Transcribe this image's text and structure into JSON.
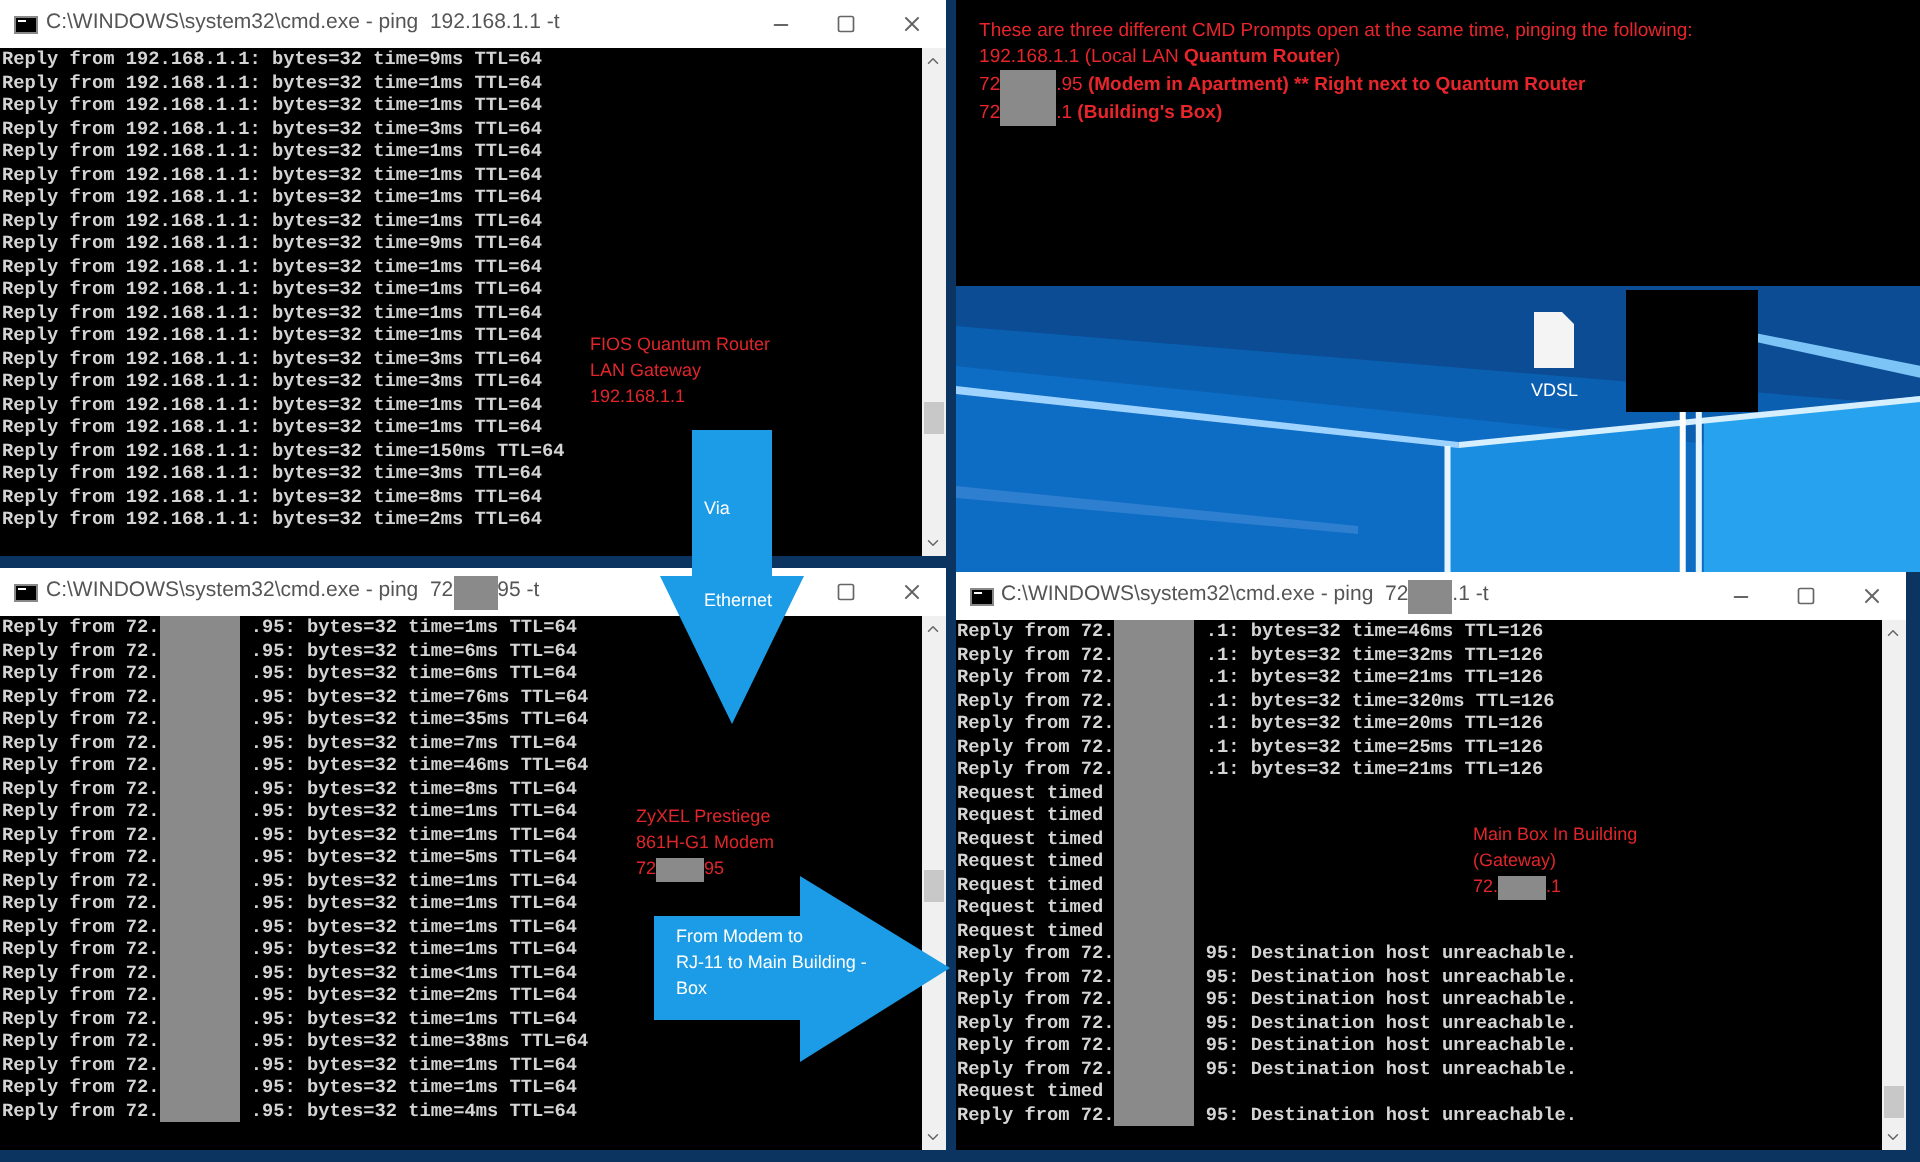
{
  "windows": [
    {
      "title": [
        {
          "kind": "text",
          "text": "C:\\WINDOWS\\system32\\cmd.exe - ping  192.168.1.1 -t"
        }
      ],
      "lines": [
        {
          "text": "Reply from 192.168.1.1: bytes=32 time=9ms TTL=64"
        },
        {
          "text": "Reply from 192.168.1.1: bytes=32 time=1ms TTL=64"
        },
        {
          "text": "Reply from 192.168.1.1: bytes=32 time=1ms TTL=64"
        },
        {
          "text": "Reply from 192.168.1.1: bytes=32 time=3ms TTL=64"
        },
        {
          "text": "Reply from 192.168.1.1: bytes=32 time=1ms TTL=64"
        },
        {
          "text": "Reply from 192.168.1.1: bytes=32 time=1ms TTL=64"
        },
        {
          "text": "Reply from 192.168.1.1: bytes=32 time=1ms TTL=64"
        },
        {
          "text": "Reply from 192.168.1.1: bytes=32 time=1ms TTL=64"
        },
        {
          "text": "Reply from 192.168.1.1: bytes=32 time=9ms TTL=64"
        },
        {
          "text": "Reply from 192.168.1.1: bytes=32 time=1ms TTL=64"
        },
        {
          "text": "Reply from 192.168.1.1: bytes=32 time=1ms TTL=64"
        },
        {
          "text": "Reply from 192.168.1.1: bytes=32 time=1ms TTL=64"
        },
        {
          "text": "Reply from 192.168.1.1: bytes=32 time=1ms TTL=64"
        },
        {
          "text": "Reply from 192.168.1.1: bytes=32 time=3ms TTL=64"
        },
        {
          "text": "Reply from 192.168.1.1: bytes=32 time=3ms TTL=64"
        },
        {
          "text": "Reply from 192.168.1.1: bytes=32 time=1ms TTL=64"
        },
        {
          "text": "Reply from 192.168.1.1: bytes=32 time=1ms TTL=64"
        },
        {
          "text": "Reply from 192.168.1.1: bytes=32 time=150ms TTL=64"
        },
        {
          "text": "Reply from 192.168.1.1: bytes=32 time=3ms TTL=64"
        },
        {
          "text": "Reply from 192.168.1.1: bytes=32 time=8ms TTL=64"
        },
        {
          "text": "Reply from 192.168.1.1: bytes=32 time=2ms TTL=64"
        }
      ],
      "annotation": [
        [
          {
            "kind": "text",
            "text": "FIOS Quantum Router"
          }
        ],
        [
          {
            "kind": "text",
            "text": "LAN Gateway"
          }
        ],
        [
          {
            "kind": "text",
            "text": "192.168.1.1"
          }
        ]
      ]
    },
    {
      "title": [
        {
          "kind": "text",
          "text": "C:\\WINDOWS\\system32\\cmd.exe - ping  72"
        },
        {
          "kind": "redacted"
        },
        {
          "kind": "text",
          "text": "95 -t"
        }
      ],
      "lines": [
        {
          "before": "Reply from 72.",
          "after": ".95: bytes=32 time=1ms TTL=64"
        },
        {
          "before": "Reply from 72.",
          "after": ".95: bytes=32 time=6ms TTL=64"
        },
        {
          "before": "Reply from 72.",
          "after": ".95: bytes=32 time=6ms TTL=64"
        },
        {
          "before": "Reply from 72.",
          "after": ".95: bytes=32 time=76ms TTL=64"
        },
        {
          "before": "Reply from 72.",
          "after": ".95: bytes=32 time=35ms TTL=64"
        },
        {
          "before": "Reply from 72.",
          "after": ".95: bytes=32 time=7ms TTL=64"
        },
        {
          "before": "Reply from 72.",
          "after": ".95: bytes=32 time=46ms TTL=64"
        },
        {
          "before": "Reply from 72.",
          "after": ".95: bytes=32 time=8ms TTL=64"
        },
        {
          "before": "Reply from 72.",
          "after": ".95: bytes=32 time=1ms TTL=64"
        },
        {
          "before": "Reply from 72.",
          "after": ".95: bytes=32 time=1ms TTL=64"
        },
        {
          "before": "Reply from 72.",
          "after": ".95: bytes=32 time=5ms TTL=64"
        },
        {
          "before": "Reply from 72.",
          "after": ".95: bytes=32 time=1ms TTL=64"
        },
        {
          "before": "Reply from 72.",
          "after": ".95: bytes=32 time=1ms TTL=64"
        },
        {
          "before": "Reply from 72.",
          "after": ".95: bytes=32 time=1ms TTL=64"
        },
        {
          "before": "Reply from 72.",
          "after": ".95: bytes=32 time=1ms TTL=64"
        },
        {
          "before": "Reply from 72.",
          "after": ".95: bytes=32 time<1ms TTL=64"
        },
        {
          "before": "Reply from 72.",
          "after": ".95: bytes=32 time=2ms TTL=64"
        },
        {
          "before": "Reply from 72.",
          "after": ".95: bytes=32 time=1ms TTL=64"
        },
        {
          "before": "Reply from 72.",
          "after": ".95: bytes=32 time=38ms TTL=64"
        },
        {
          "before": "Reply from 72.",
          "after": ".95: bytes=32 time=1ms TTL=64"
        },
        {
          "before": "Reply from 72.",
          "after": ".95: bytes=32 time=1ms TTL=64"
        },
        {
          "before": "Reply from 72.",
          "after": ".95: bytes=32 time=4ms TTL=64"
        }
      ],
      "annotation": [
        [
          {
            "kind": "text",
            "text": "ZyXEL Prestiege"
          }
        ],
        [
          {
            "kind": "text",
            "text": "861H-G1 Modem"
          }
        ],
        [
          {
            "kind": "text",
            "text": "72"
          },
          {
            "kind": "redacted"
          },
          {
            "kind": "text",
            "text": "95"
          }
        ]
      ]
    },
    {
      "title": [
        {
          "kind": "text",
          "text": "C:\\WINDOWS\\system32\\cmd.exe - ping  72"
        },
        {
          "kind": "redacted"
        },
        {
          "kind": "text",
          "text": ".1 -t"
        }
      ],
      "lines": [
        {
          "before": "Reply from 72.",
          "after": ".1: bytes=32 time=46ms TTL=126"
        },
        {
          "before": "Reply from 72.",
          "after": ".1: bytes=32 time=32ms TTL=126"
        },
        {
          "before": "Reply from 72.",
          "after": ".1: bytes=32 time=21ms TTL=126"
        },
        {
          "before": "Reply from 72.",
          "after": ".1: bytes=32 time=320ms TTL=126"
        },
        {
          "before": "Reply from 72.",
          "after": ".1: bytes=32 time=20ms TTL=126"
        },
        {
          "before": "Reply from 72.",
          "after": ".1: bytes=32 time=25ms TTL=126"
        },
        {
          "before": "Reply from 72.",
          "after": ".1: bytes=32 time=21ms TTL=126"
        },
        {
          "before": "Request timed"
        },
        {
          "before": "Request timed"
        },
        {
          "before": "Request timed"
        },
        {
          "before": "Request timed"
        },
        {
          "before": "Request timed"
        },
        {
          "before": "Request timed"
        },
        {
          "before": "Request timed"
        },
        {
          "before": "Reply from 72.",
          "after": "95: Destination host unreachable."
        },
        {
          "before": "Reply from 72.",
          "after": "95: Destination host unreachable."
        },
        {
          "before": "Reply from 72.",
          "after": "95: Destination host unreachable."
        },
        {
          "before": "Reply from 72.",
          "after": "95: Destination host unreachable."
        },
        {
          "before": "Reply from 72.",
          "after": "95: Destination host unreachable."
        },
        {
          "before": "Reply from 72.",
          "after": "95: Destination host unreachable."
        },
        {
          "before": "Request timed"
        },
        {
          "before": "Reply from 72.",
          "after": "95: Destination host unreachable."
        }
      ],
      "annotation": [
        [
          {
            "kind": "text",
            "text": "Main Box In Building"
          }
        ],
        [
          {
            "kind": "text",
            "text": "(Gateway)"
          }
        ],
        [
          {
            "kind": "text",
            "text": "72."
          },
          {
            "kind": "redacted"
          },
          {
            "kind": "text",
            "text": ".1"
          }
        ]
      ]
    }
  ],
  "note": [
    [
      {
        "kind": "text",
        "text": "These are three different CMD Prompts open at the same time, pinging the following:",
        "bold": false
      }
    ],
    [
      {
        "kind": "text",
        "text": "192.168.1.1 (Local LAN ",
        "bold": false
      },
      {
        "kind": "text",
        "text": "Quantum Router",
        "bold": true
      },
      {
        "kind": "text",
        "text": ")",
        "bold": false
      }
    ],
    [
      {
        "kind": "text",
        "text": "72",
        "bold": false
      },
      {
        "kind": "redacted"
      },
      {
        "kind": "text",
        "text": ".95 ",
        "bold": false
      },
      {
        "kind": "text",
        "text": "(Modem in Apartment) ** Right next to Quantum Router",
        "bold": true
      }
    ],
    [
      {
        "kind": "text",
        "text": "72",
        "bold": false
      },
      {
        "kind": "redacted"
      },
      {
        "kind": "text",
        "text": ".1 ",
        "bold": false
      },
      {
        "kind": "text",
        "text": "(Building's Box)",
        "bold": true
      }
    ]
  ],
  "desktop": {
    "icon_label": "VDSL"
  },
  "arrows": [
    {
      "kind": "down",
      "lines": [
        "Via",
        "Ethernet"
      ]
    },
    {
      "kind": "right",
      "lines": [
        "From Modem to",
        "RJ-11 to Main Building -",
        "Box"
      ]
    }
  ]
}
